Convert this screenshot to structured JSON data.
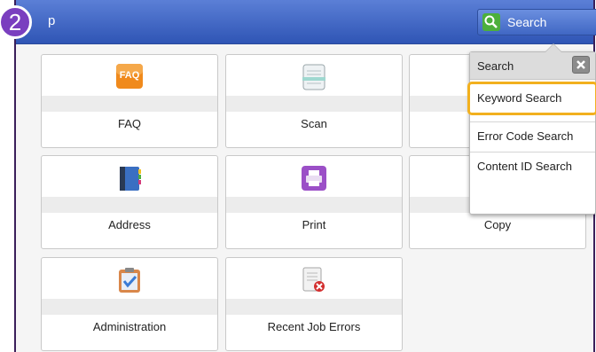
{
  "step": {
    "number": "2"
  },
  "header": {
    "title_fragment": "p",
    "search_label": "Search"
  },
  "tiles": [
    {
      "label": "FAQ",
      "icon": "faq-icon",
      "icon_text": "FAQ"
    },
    {
      "label": "Scan",
      "icon": "scan-icon"
    },
    {
      "label": "",
      "icon": "hidden-tile-icon"
    },
    {
      "label": "Address",
      "icon": "address-book-icon"
    },
    {
      "label": "Print",
      "icon": "printer-icon"
    },
    {
      "label": "Copy",
      "icon": "copy-icon"
    },
    {
      "label": "Administration",
      "icon": "clipboard-check-icon"
    },
    {
      "label": "Recent Job Errors",
      "icon": "document-error-icon"
    }
  ],
  "popup": {
    "title": "Search",
    "items": [
      "Keyword Search",
      "Error Code Search",
      "Content ID Search"
    ],
    "highlighted_item": "Keyword Search"
  },
  "colors": {
    "titlebar": "#3e66c6",
    "highlight": "#f2b01e",
    "step_badge": "#7a3fbf"
  }
}
